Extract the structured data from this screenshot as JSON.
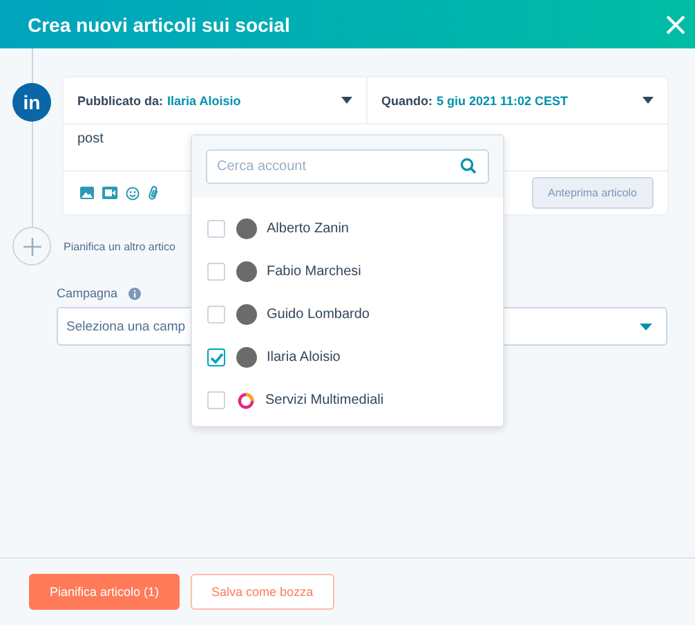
{
  "window": {
    "title": "Crea nuovi articoli sui social"
  },
  "network": {
    "logo": "in"
  },
  "post": {
    "published_by_label": "Pubblicato da:",
    "published_by": "Ilaria Aloisio",
    "when_label": "Quando:",
    "when": "5 giu 2021 11:02 CEST",
    "text": "post",
    "preview_button": "Anteprima articolo"
  },
  "add_post": {
    "label": "Pianifica un altro artico"
  },
  "campaign": {
    "label": "Campagna",
    "placeholder": "Seleziona una camp"
  },
  "account_menu": {
    "search_placeholder": "Cerca account",
    "accounts": [
      {
        "name": "Alberto Zanin",
        "checked": false,
        "kind": "person"
      },
      {
        "name": "Fabio Marchesi",
        "checked": false,
        "kind": "person"
      },
      {
        "name": "Guido Lombardo",
        "checked": false,
        "kind": "person"
      },
      {
        "name": "Ilaria Aloisio",
        "checked": true,
        "kind": "person"
      },
      {
        "name": "Servizi Multimediali",
        "checked": false,
        "kind": "brand"
      }
    ]
  },
  "buttons": [
    {
      "label": "Pianifica articolo (1)",
      "kind": "primary"
    },
    {
      "label": "Salva come bozza",
      "kind": "secondary"
    }
  ]
}
